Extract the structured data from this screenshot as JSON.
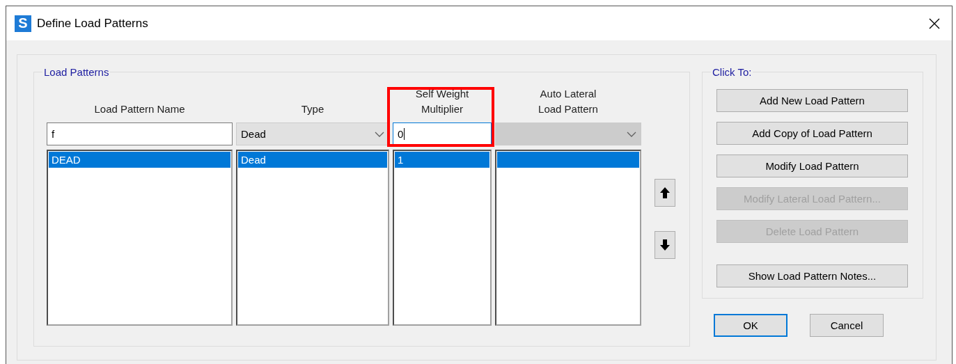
{
  "window": {
    "title": "Define Load Patterns",
    "app_icon": "S"
  },
  "load_patterns": {
    "title": "Load Patterns",
    "columns": [
      {
        "header": "Load Pattern Name",
        "kind": "text",
        "value": "f",
        "focused": false,
        "disabled": false,
        "highlighted": false,
        "rows": [
          {
            "text": "DEAD",
            "selected": true
          }
        ]
      },
      {
        "header": "Type",
        "kind": "combo",
        "value": "Dead",
        "focused": false,
        "disabled": false,
        "highlighted": false,
        "rows": [
          {
            "text": "Dead",
            "selected": true
          }
        ]
      },
      {
        "header": "Self Weight\nMultiplier",
        "kind": "text",
        "value": "0",
        "focused": true,
        "disabled": false,
        "highlighted": true,
        "rows": [
          {
            "text": "1",
            "selected": true
          }
        ]
      },
      {
        "header": "Auto Lateral\nLoad Pattern",
        "kind": "combo",
        "focused": false,
        "disabled": true,
        "highlighted": false,
        "rows": [
          {
            "selected": true
          }
        ]
      }
    ]
  },
  "click_to": {
    "title": "Click To:",
    "buttons": [
      {
        "label": "Add New Load Pattern",
        "disabled": false
      },
      {
        "label": "Add Copy of Load Pattern",
        "disabled": false
      },
      {
        "label": "Modify Load Pattern",
        "disabled": false
      },
      {
        "label": "Modify Lateral Load Pattern...",
        "disabled": true
      },
      {
        "label": "Delete Load Pattern",
        "disabled": true
      },
      {
        "label": "Show Load Pattern Notes...",
        "disabled": false
      }
    ]
  },
  "dialog_buttons": [
    {
      "label": "OK",
      "default": true
    },
    {
      "label": "Cancel",
      "default": false
    }
  ]
}
